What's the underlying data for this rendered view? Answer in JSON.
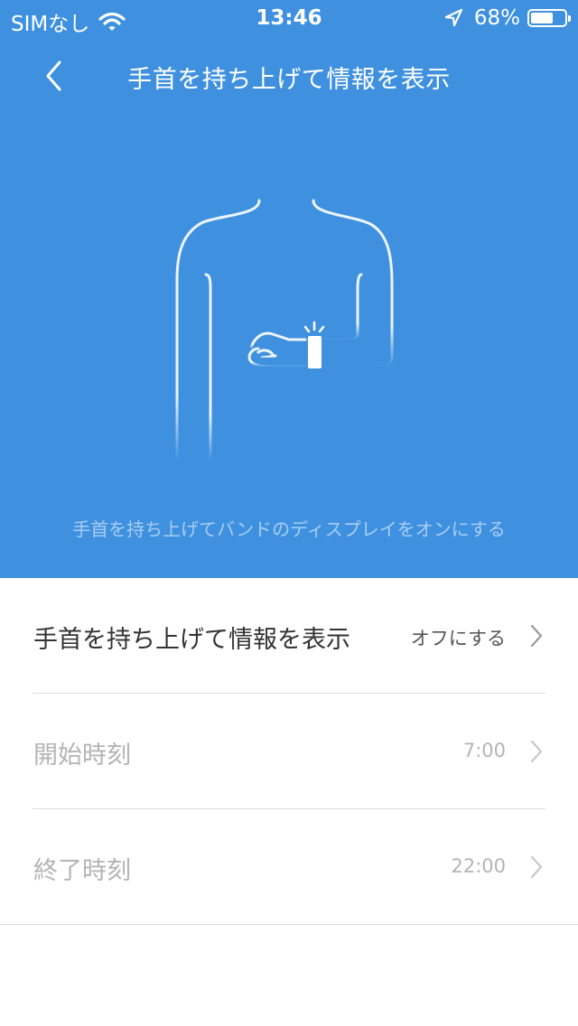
{
  "status_bar": {
    "carrier": "SIMなし",
    "time": "13:46",
    "battery_percent": "68%",
    "battery_level": 0.68,
    "icons": [
      "wifi-icon",
      "location-arrow-icon",
      "battery-icon"
    ]
  },
  "nav": {
    "title": "手首を持ち上げて情報を表示",
    "back_icon": "chevron-left-icon"
  },
  "hero": {
    "background_color": "#3f91e0",
    "illustration": "person-raising-wrist-with-band",
    "caption": "手首を持ち上げてバンドのディスプレイをオンにする"
  },
  "settings": {
    "rows": [
      {
        "label": "手首を持ち上げて情報を表示",
        "value": "オフにする",
        "enabled": true,
        "icon": "chevron-right-icon"
      },
      {
        "label": "開始時刻",
        "value": "7:00",
        "enabled": false,
        "icon": "chevron-right-icon"
      },
      {
        "label": "終了時刻",
        "value": "22:00",
        "enabled": false,
        "icon": "chevron-right-icon"
      }
    ]
  }
}
